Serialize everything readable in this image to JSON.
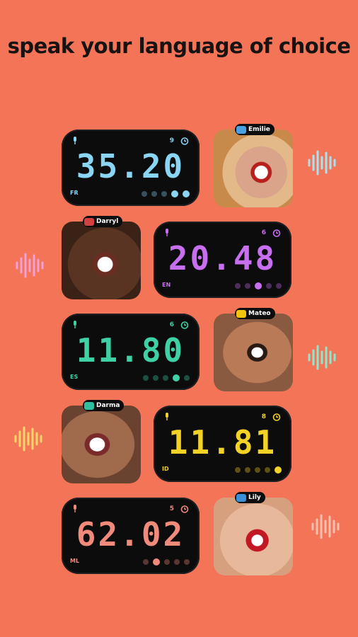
{
  "headline": "speak your language of choice",
  "rows": [
    {
      "digits": "35.20",
      "color": "#8ad4f4",
      "count": "9",
      "lang": "FR",
      "speaker": "Emilie",
      "flag": "#4aa0e0",
      "wave_color": "#a7e2f0"
    },
    {
      "digits": "20.48",
      "color": "#c86ff0",
      "count": "6",
      "lang": "EN",
      "speaker": "Darryl",
      "flag": "#d24040",
      "wave_color": "#f2a2d6"
    },
    {
      "digits": "11.80",
      "color": "#3fd1a6",
      "count": "6",
      "lang": "ES",
      "speaker": "Mateo",
      "flag": "#f1c40f",
      "wave_color": "#8ee6cc"
    },
    {
      "digits": "11.81",
      "color": "#f3d226",
      "count": "8",
      "lang": "ID",
      "speaker": "Darma",
      "flag": "#2fbf9f",
      "wave_color": "#ffd66a"
    },
    {
      "digits": "62.02",
      "color": "#f08a7a",
      "count": "5",
      "lang": "ML",
      "speaker": "Lily",
      "flag": "#3a8fd8",
      "wave_color": "#f8c0b0"
    }
  ]
}
